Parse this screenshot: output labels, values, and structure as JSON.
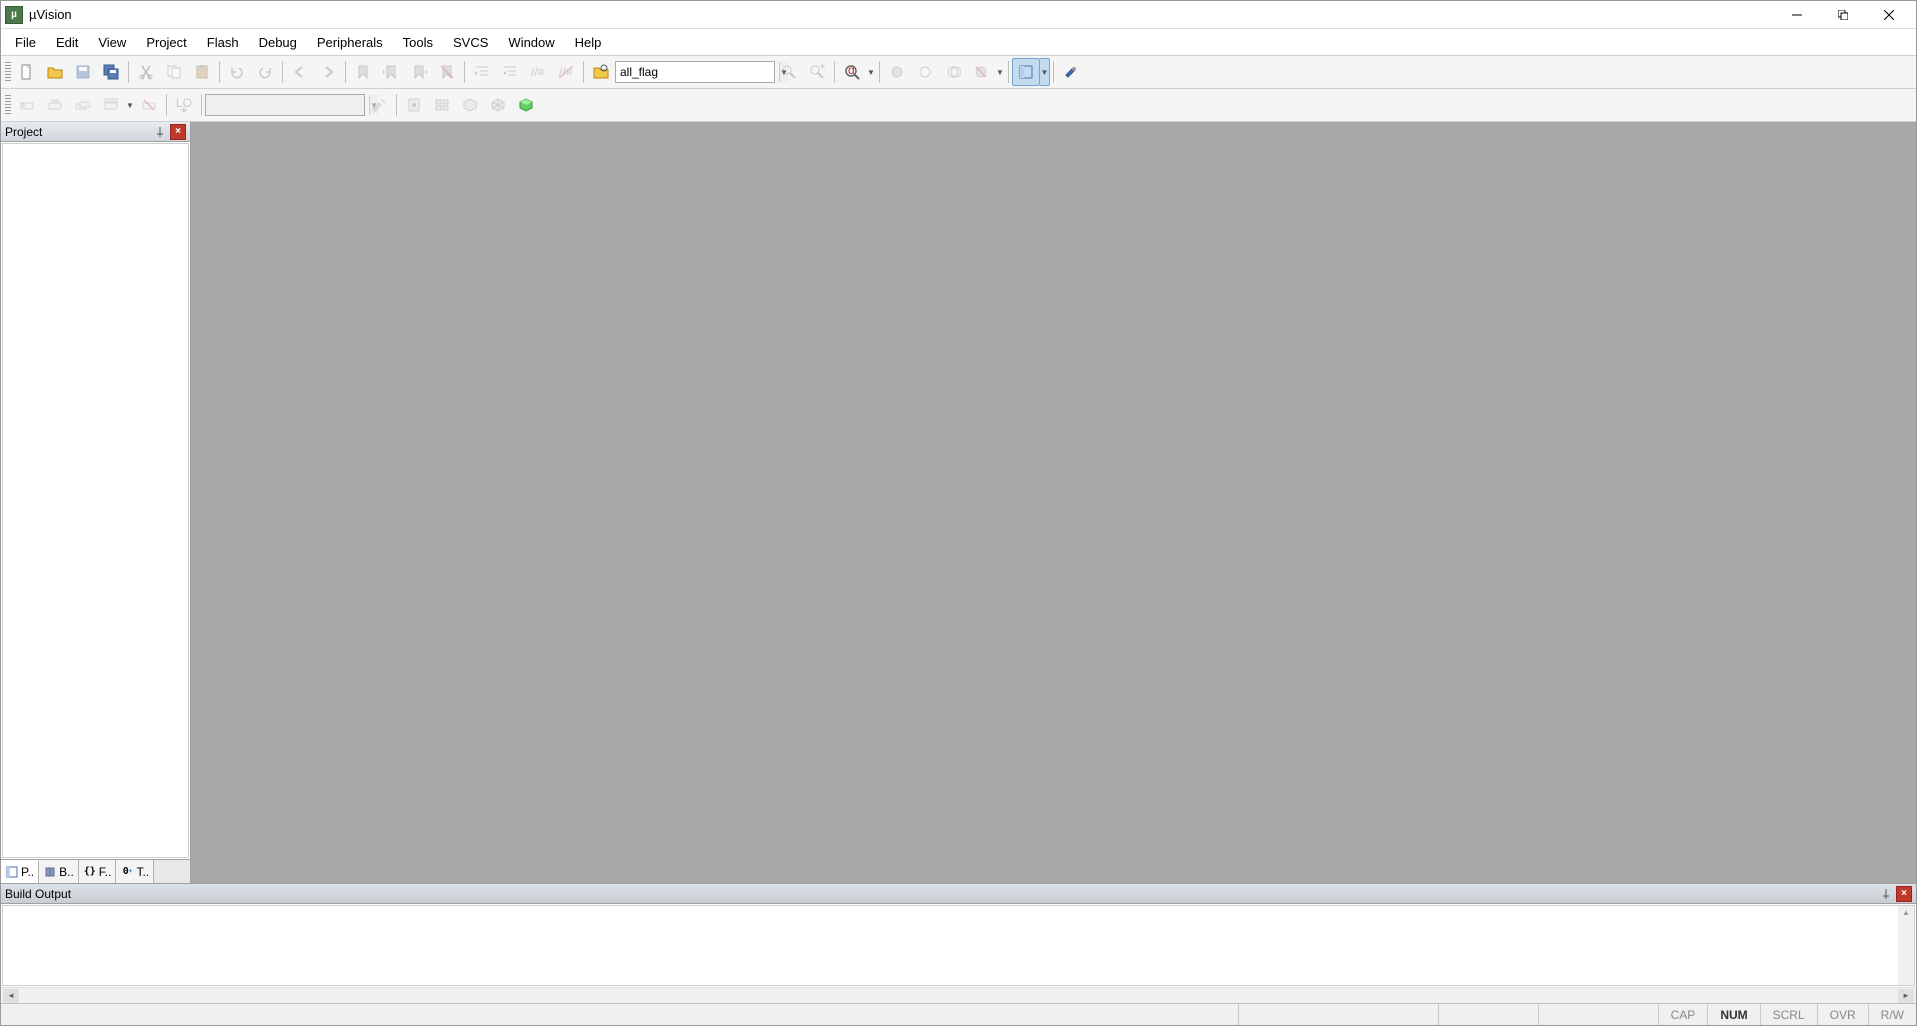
{
  "titlebar": {
    "app_title": "µVision"
  },
  "menu": {
    "items": [
      "File",
      "Edit",
      "View",
      "Project",
      "Flash",
      "Debug",
      "Peripherals",
      "Tools",
      "SVCS",
      "Window",
      "Help"
    ]
  },
  "toolbar1": {
    "find_combo": "all_flag"
  },
  "toolbar2": {
    "target_combo": ""
  },
  "panels": {
    "project": {
      "title": "Project"
    },
    "build_output": {
      "title": "Build Output"
    },
    "tabs": [
      {
        "label": "P..",
        "icon": "project-icon"
      },
      {
        "label": "B..",
        "icon": "books-icon"
      },
      {
        "label": "F..",
        "icon": "functions-icon"
      },
      {
        "label": "T..",
        "icon": "templates-icon"
      }
    ]
  },
  "status": {
    "cap": "CAP",
    "num": "NUM",
    "scrl": "SCRL",
    "ovr": "OVR",
    "rw": "R/W"
  }
}
